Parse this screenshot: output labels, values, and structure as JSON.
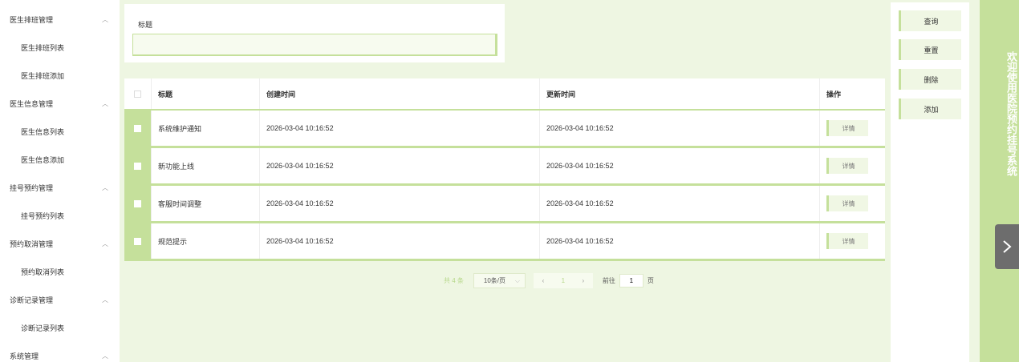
{
  "sidebar": {
    "groups": [
      {
        "label": "医生排班管理",
        "items": [
          "医生排班列表",
          "医生排班添加"
        ]
      },
      {
        "label": "医生信息管理",
        "items": [
          "医生信息列表",
          "医生信息添加"
        ]
      },
      {
        "label": "挂号预约管理",
        "items": [
          "挂号预约列表"
        ]
      },
      {
        "label": "预约取消管理",
        "items": [
          "预约取消列表"
        ]
      },
      {
        "label": "诊断记录管理",
        "items": [
          "诊断记录列表"
        ]
      },
      {
        "label": "系统管理",
        "items": []
      }
    ]
  },
  "search": {
    "label": "标题",
    "value": "",
    "placeholder": ""
  },
  "table": {
    "headers": [
      "标题",
      "创建时间",
      "更新时间",
      "操作"
    ],
    "rows": [
      {
        "title": "系统维护通知",
        "created": "2026-03-04 10:16:52",
        "updated": "2026-03-04 10:16:52",
        "action": "详情"
      },
      {
        "title": "新功能上线",
        "created": "2026-03-04 10:16:52",
        "updated": "2026-03-04 10:16:52",
        "action": "详情"
      },
      {
        "title": "客服时间调整",
        "created": "2026-03-04 10:16:52",
        "updated": "2026-03-04 10:16:52",
        "action": "详情"
      },
      {
        "title": "规范提示",
        "created": "2026-03-04 10:16:52",
        "updated": "2026-03-04 10:16:52",
        "action": "详情"
      }
    ]
  },
  "pagination": {
    "total": "共 4 条",
    "page_size": "10条/页",
    "current": "1",
    "goto_label": "前往",
    "goto_value": "1",
    "page_suffix": "页"
  },
  "actions": {
    "query": "查询",
    "reset": "重置",
    "delete": "删除",
    "add": "添加"
  },
  "banner": {
    "text": "欢迎使用医院预约挂号系统"
  },
  "colors": {
    "accent": "#c5e09b",
    "background": "#eef6e2"
  },
  "icons": {
    "chevron": "chevron-up-icon",
    "arrow": "chevron-right-icon"
  }
}
